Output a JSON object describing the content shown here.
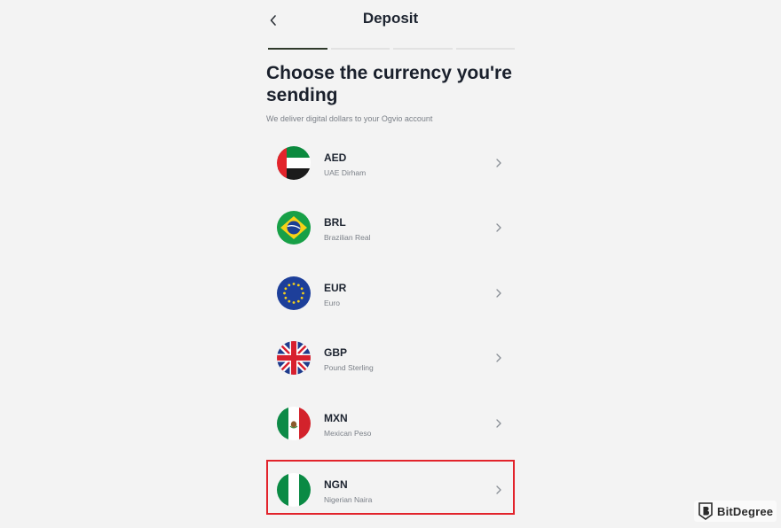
{
  "header": {
    "title": "Deposit"
  },
  "progress": {
    "steps_total": 4,
    "steps_completed": 1
  },
  "main": {
    "heading": "Choose the currency you're sending",
    "subtitle": "We deliver digital dollars to your Ogvio account"
  },
  "currencies": [
    {
      "code": "AED",
      "name": "UAE Dirham",
      "flag": "uae-flag-icon"
    },
    {
      "code": "BRL",
      "name": "Brazilian Real",
      "flag": "brazil-flag-icon"
    },
    {
      "code": "EUR",
      "name": "Euro",
      "flag": "eu-flag-icon"
    },
    {
      "code": "GBP",
      "name": "Pound Sterling",
      "flag": "uk-flag-icon"
    },
    {
      "code": "MXN",
      "name": "Mexican Peso",
      "flag": "mexico-flag-icon"
    },
    {
      "code": "NGN",
      "name": "Nigerian Naira",
      "flag": "nigeria-flag-icon",
      "highlighted": true
    }
  ],
  "colors": {
    "highlight_border": "#e2232b",
    "progress_active": "#2f3a2b",
    "background": "#f3f3f3"
  },
  "watermark": {
    "text": "BitDegree"
  }
}
